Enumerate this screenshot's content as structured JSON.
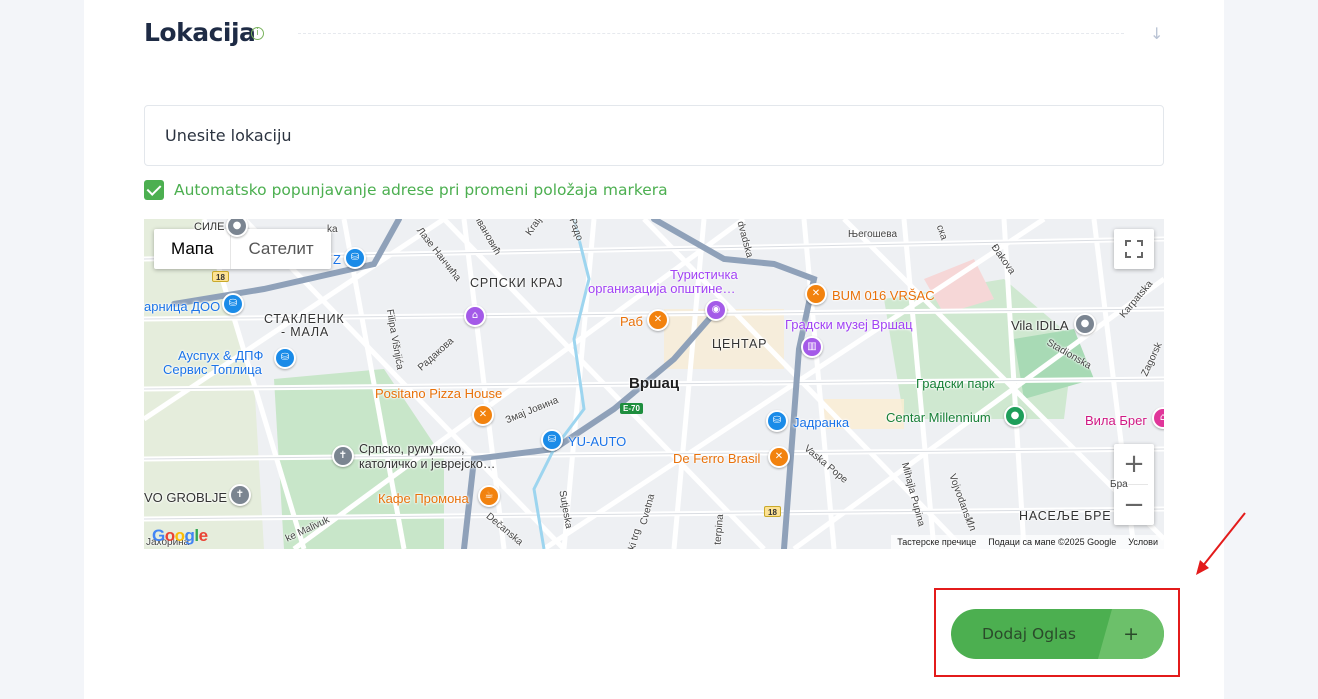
{
  "section": {
    "title": "Lokacija",
    "info_icon": "i",
    "collapse_icon": "↓"
  },
  "location_input": {
    "placeholder": "Unesite lokaciju",
    "value": ""
  },
  "auto_fill": {
    "checked": true,
    "label": "Automatsko popunjavanje adrese pri promeni položaja markera"
  },
  "map": {
    "type_tabs": [
      "Мапа",
      "Сателит"
    ],
    "active_tab": "Мапа",
    "zoom_in": "+",
    "zoom_out": "−",
    "google_logo": [
      "G",
      "o",
      "o",
      "g",
      "l",
      "e"
    ],
    "footer": [
      "Тастерске пречице",
      "Подаци са мапе ©2025 Google",
      "Услови"
    ],
    "areas": [
      "СРПСКИ КРАЈ",
      "СТАКЛЕНИК",
      "- МАЛА",
      "ЦЕНТАР",
      "НАСЕЉЕ БРЕ"
    ],
    "city": "Вршац",
    "pois": {
      "turist_1": "Туристичка",
      "turist_2": "организација општине…",
      "bum": "BUM 016 VRŠAC",
      "raba": "Раб",
      "muzej": "Градски музеј Вршац",
      "vila_idila": "Vila IDILA",
      "park": "Градски парк",
      "millennium": "Centar Millennium",
      "vila_breg": "Вила Брег",
      "pizza": "Positano Pizza House",
      "yu_auto": "YU-AUTO",
      "jadranka": "Јадранка",
      "ferro": "De Ferro Brasil",
      "groblje_1": "Српско, румунско,",
      "groblje_2": "католичко и јеврејско…",
      "groblje_3": "VO GROBLJE",
      "promona": "Кафе Промона",
      "ausp_1": "Ауспух & ДПФ",
      "ausp_2": "Сервис Топлица",
      "arnica": "арница ДОО",
      "sile": "СИЛЕ",
      "z": "Z"
    },
    "streets": [
      "Лазе Нанчића",
      "Filipa Višnjića",
      "Радакова",
      "Змај Јовина",
      "Vaska Pope",
      "Mihajla Pupina",
      "Vojvodanski",
      "Sutjeska",
      "Cvetna",
      "Dečanska",
      "ke Malivuk",
      "Јахорина",
      "Stadionska",
      "Karpatska",
      "Zagorsk",
      "Đakova",
      "Његошева",
      "dvadska",
      "ска",
      "Ивановић",
      "Kralj",
      "Радо",
      "Ил",
      "ki trg",
      "terpina",
      "ka",
      "Бра"
    ],
    "road_shields": [
      "18",
      "E-70",
      "18"
    ]
  },
  "submit": {
    "label": "Dodaj Oglas",
    "icon": "+"
  }
}
